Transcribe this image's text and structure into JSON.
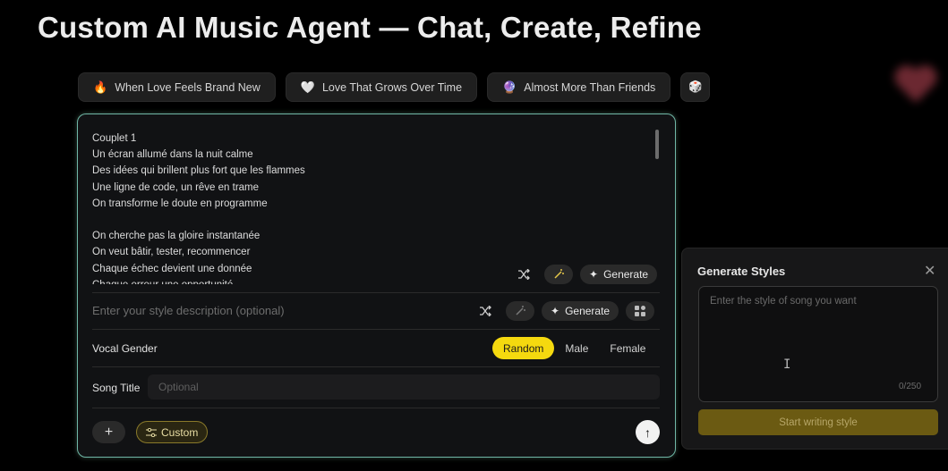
{
  "page": {
    "title": "Custom AI Music Agent — Chat, Create, Refine"
  },
  "chips": [
    {
      "emoji": "🔥",
      "label": "When Love Feels Brand New"
    },
    {
      "emoji": "🤍",
      "label": "Love That Grows Over Time"
    },
    {
      "emoji": "🔮",
      "label": "Almost More Than Friends"
    }
  ],
  "dice_icon": "🎲",
  "lyrics": {
    "lines_block_1": [
      "Couplet 1",
      "Un écran allumé dans la nuit calme",
      "Des idées qui brillent plus fort que les flammes",
      "Une ligne de code, un rêve en trame",
      "On transforme le doute en programme"
    ],
    "lines_block_2": [
      "On cherche pas la gloire instantanée",
      "On veut bâtir, tester, recommencer",
      "Chaque échec devient une donnée",
      "Chaque erreur une opportunité"
    ]
  },
  "lyrics_tools": {
    "generate_label": "Generate"
  },
  "style": {
    "placeholder": "Enter your style description (optional)",
    "generate_label": "Generate"
  },
  "vocal": {
    "label": "Vocal Gender",
    "options": [
      "Random",
      "Male",
      "Female"
    ],
    "selected": "Random"
  },
  "song_title": {
    "label": "Song Title",
    "placeholder": "Optional"
  },
  "bottom": {
    "plus_label": "+",
    "custom_label": "Custom",
    "send_icon": "↑"
  },
  "styles_panel": {
    "title": "Generate Styles",
    "close_icon": "✕",
    "placeholder": "Enter the style of song you want",
    "counter": "0/250",
    "submit_label": "Start writing style"
  },
  "colors": {
    "accent_yellow": "#f5d90f",
    "composer_border": "#6fb7a6",
    "submit_bg": "#6b5a12"
  }
}
